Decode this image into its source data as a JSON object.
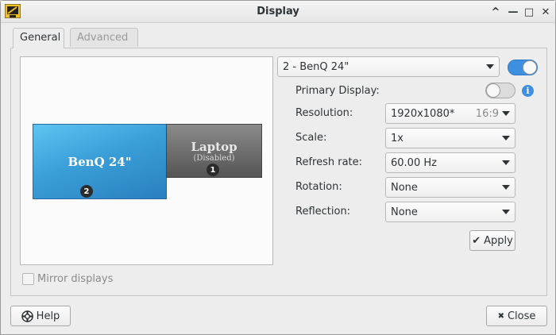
{
  "window": {
    "title": "Display",
    "controls": {
      "minimize": "^",
      "shade": "—",
      "maximize": "□",
      "close": "✕"
    }
  },
  "tabs": [
    {
      "label": "General",
      "active": true
    },
    {
      "label": "Advanced",
      "active": false
    }
  ],
  "preview": {
    "monitors": [
      {
        "name": "BenQ 24\"",
        "number": "2",
        "color": "#3a9fd9"
      },
      {
        "name": "Laptop",
        "status": "(Disabled)",
        "number": "1",
        "color": "#6a6a6a"
      }
    ]
  },
  "mirror": {
    "label": "Mirror displays",
    "checked": false
  },
  "display_select": {
    "value": "2 - BenQ 24\"",
    "enabled": true
  },
  "settings": {
    "primary_label": "Primary Display:",
    "primary_on": false,
    "resolution_label": "Resolution:",
    "resolution_value": "1920x1080*",
    "resolution_ratio": "16:9",
    "scale_label": "Scale:",
    "scale_value": "1x",
    "refresh_label": "Refresh rate:",
    "refresh_value": "60.00 Hz",
    "rotation_label": "Rotation:",
    "rotation_value": "None",
    "reflection_label": "Reflection:",
    "reflection_value": "None"
  },
  "buttons": {
    "apply_icon": "✔",
    "apply": "Apply",
    "help": "Help",
    "close_icon": "✖",
    "close": "Close"
  },
  "colors": {
    "accent": "#3f8fe0"
  }
}
